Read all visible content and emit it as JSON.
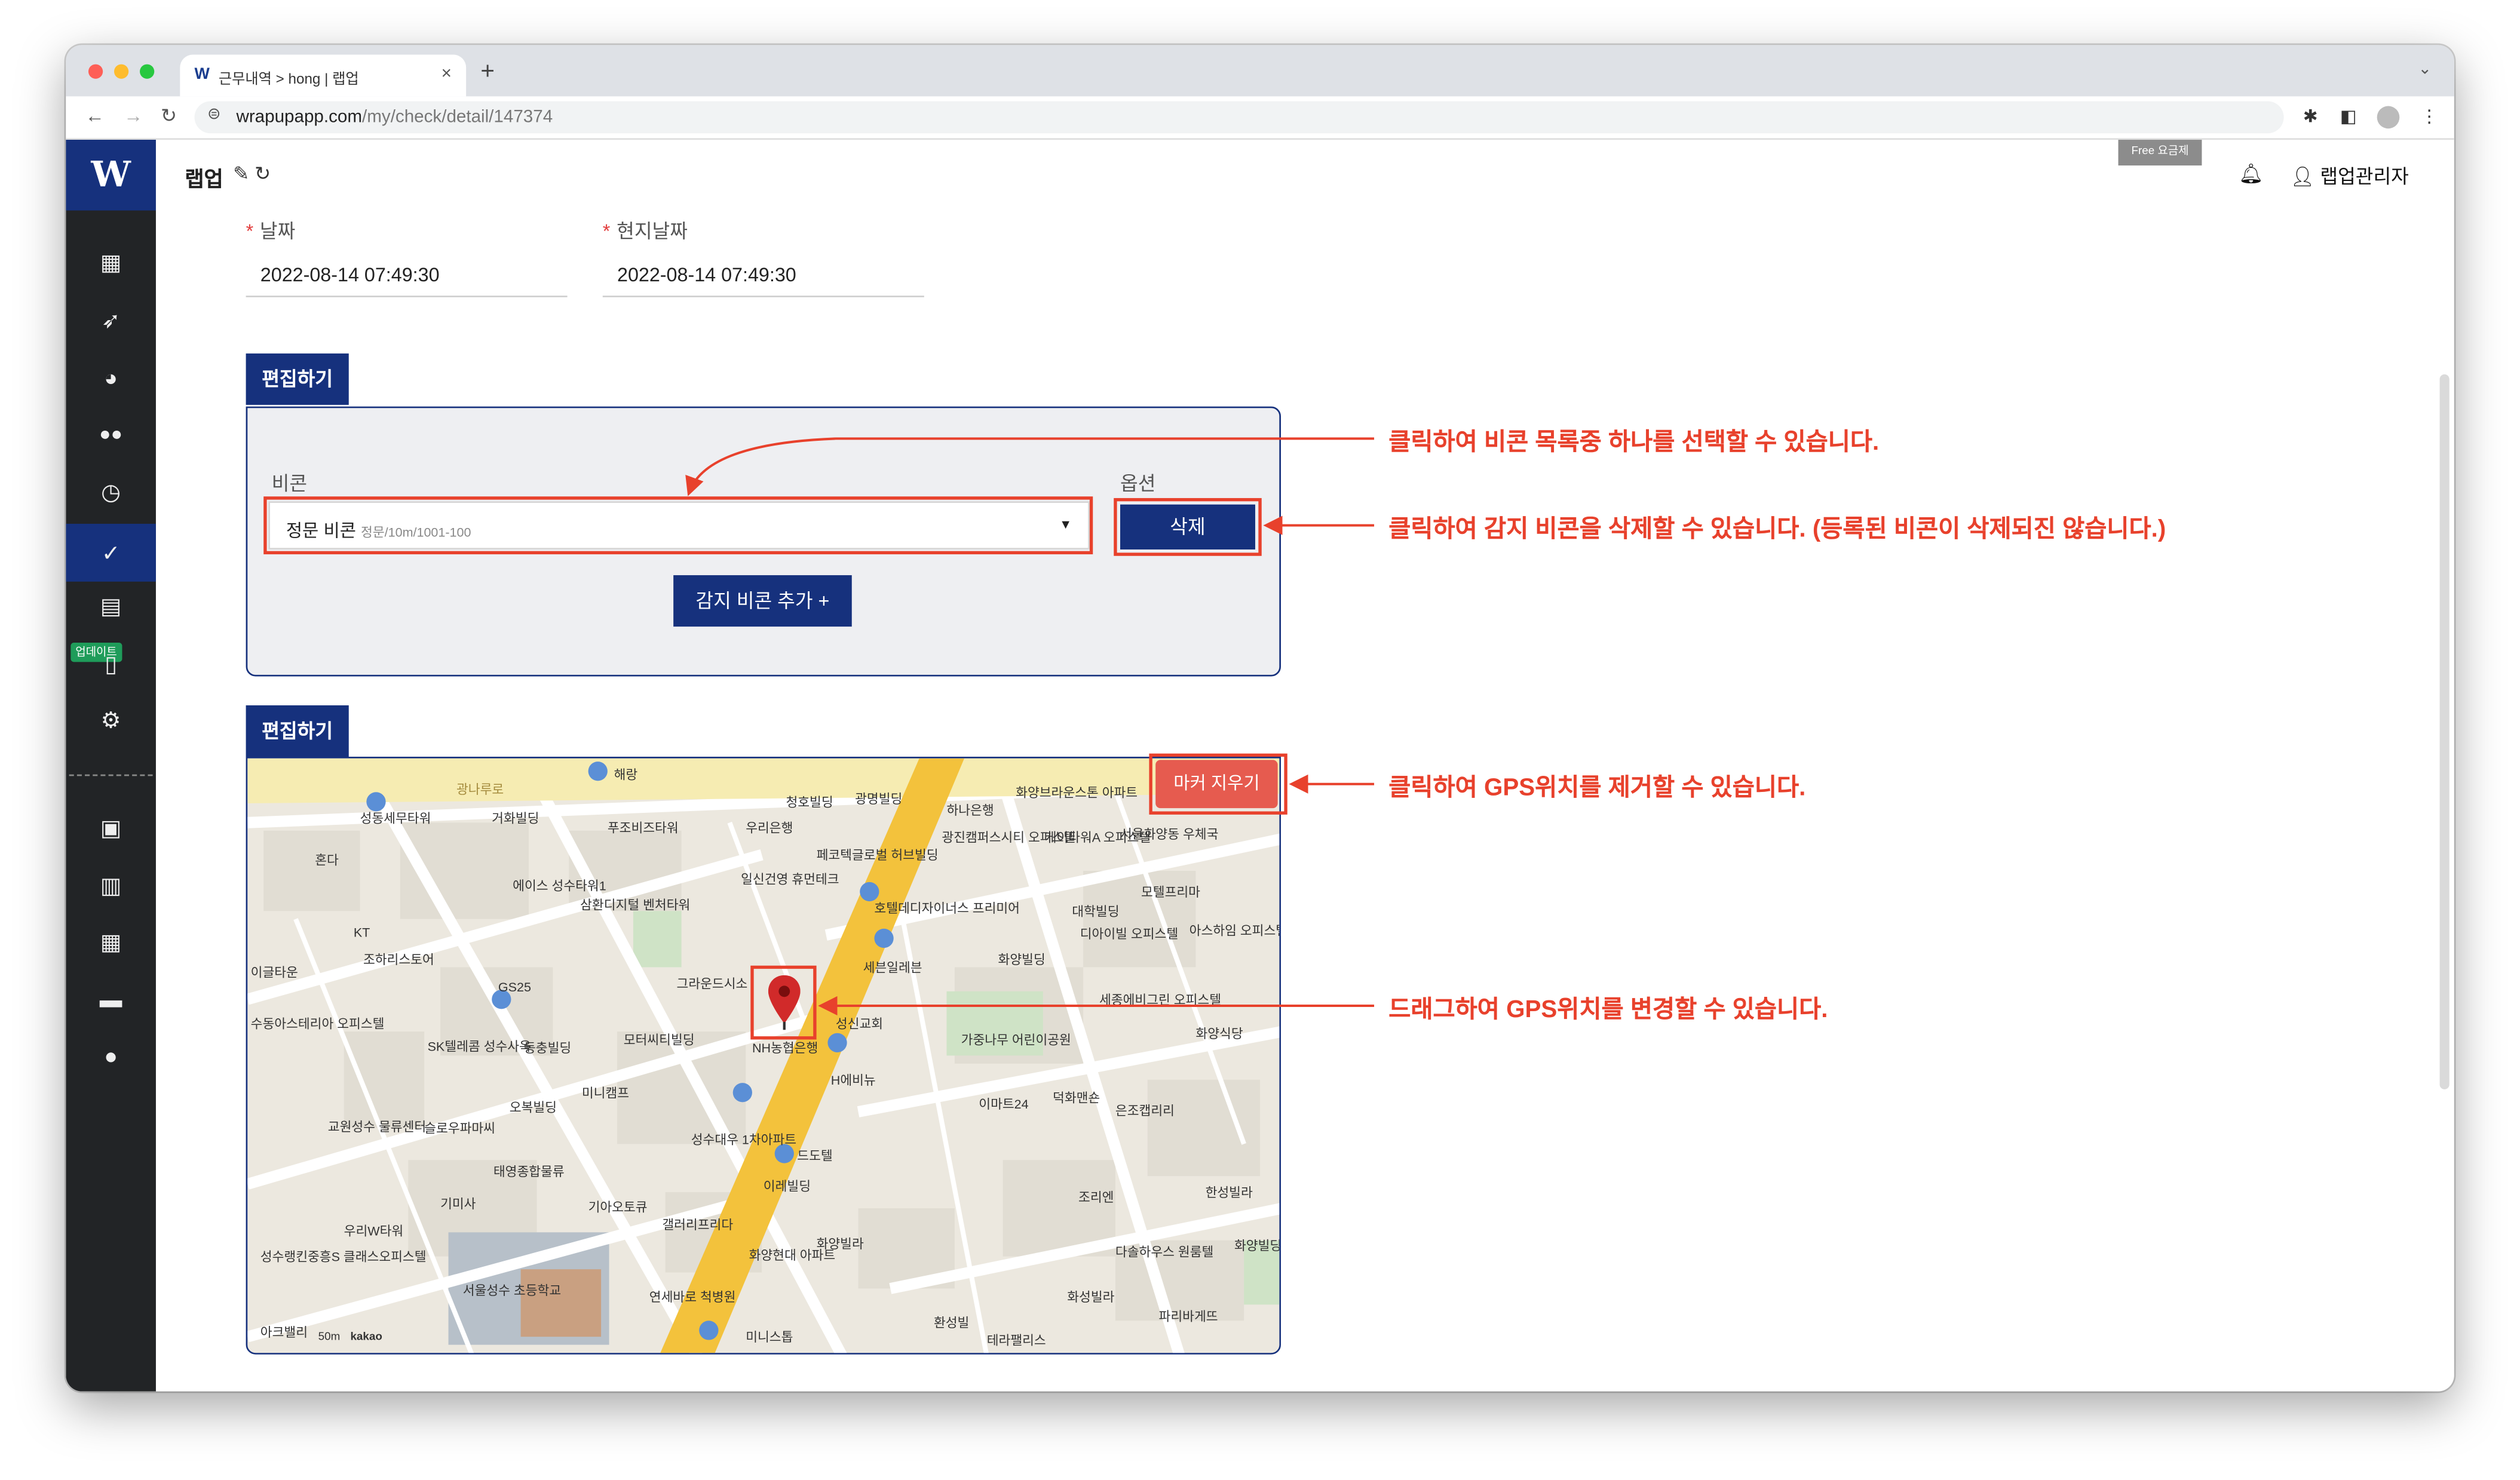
{
  "browser": {
    "tab_title": "근무내역 > hong | 랩업",
    "favicon": "W",
    "url_host": "wrapupapp.com",
    "url_path": "/my/check/detail/147374",
    "new_tab": "+",
    "close": "×"
  },
  "sidebar": {
    "logo": "W",
    "badge": "업데이트",
    "items": [
      {
        "icon": "dashboard-icon",
        "glyph": "▦"
      },
      {
        "icon": "rocket-icon",
        "glyph": "➶"
      },
      {
        "icon": "palette-icon",
        "glyph": "◕"
      },
      {
        "icon": "group-icon",
        "glyph": "👥"
      },
      {
        "icon": "alarm-icon",
        "glyph": "⏰"
      },
      {
        "icon": "check-icon",
        "glyph": "✓"
      },
      {
        "icon": "id-card-icon",
        "glyph": "▤"
      },
      {
        "icon": "mobile-icon",
        "glyph": "▯"
      },
      {
        "icon": "gear-icon",
        "glyph": "⚙"
      },
      {
        "icon": "contact-icon",
        "glyph": "▣"
      },
      {
        "icon": "building-icon",
        "glyph": "▥"
      },
      {
        "icon": "store-icon",
        "glyph": "▦"
      },
      {
        "icon": "chat-icon",
        "glyph": "▬"
      },
      {
        "icon": "help-chat-icon",
        "glyph": "●"
      }
    ]
  },
  "header": {
    "brand": "랩업",
    "plan_badge": "Free 요금제",
    "user": "랩업관리자"
  },
  "form": {
    "date_label": "날짜",
    "date_value": "2022-08-14 07:49:30",
    "local_date_label": "현지날짜",
    "local_date_value": "2022-08-14 07:49:30",
    "required_mark": "*"
  },
  "beacon_section": {
    "tab_label": "편집하기",
    "beacon_label": "비콘",
    "option_label": "옵션",
    "selected_beacon": "정문 비콘",
    "selected_beacon_detail": "정문/10m/1001-100",
    "delete_button": "삭제",
    "add_button": "감지 비콘 추가 +"
  },
  "map_section": {
    "tab_label": "편집하기",
    "clear_marker_button": "마커 지우기",
    "scale_label": "50m",
    "brand": "kakao"
  },
  "annotations": {
    "select_hint": "클릭하여 비콘 목록중 하나를 선택할 수 있습니다.",
    "delete_hint": "클릭하여 감지 비콘을 삭제할 수 있습니다. (등록된 비콘이 삭제되진 않습니다.)",
    "clear_hint": "클릭하여 GPS위치를 제거할 수 있습니다.",
    "drag_hint": "드래그하여 GPS위치를 변경할 수 있습니다."
  },
  "map_labels": [
    "해랑",
    "성동세무타워",
    "거화빌딩",
    "푸조비즈타워",
    "우리은행",
    "청호빌딩",
    "광명빌딩",
    "하나은행",
    "화양브라운스톤 아파트",
    "광진캠퍼스시티 오피스텔",
    "케이타워A 오피스텔",
    "서울화양동 우체국",
    "혼다",
    "에이스 성수타워1",
    "삼환디지털 벤처타워",
    "일신건영 휴먼테크",
    "페코텍글로벌 허브빌딩",
    "호텔데디자이너스 프리미어",
    "모텔프리마",
    "대학빌딩",
    "디아이빌 오피스텔",
    "아스하임 오피스텔",
    "KT",
    "조하리스토어",
    "GS25",
    "그라운드시소",
    "세븐일레븐",
    "화양빌딩",
    "이글타운",
    "수동아스테리아 오피스텔",
    "SK텔레콤 성수사옥",
    "동충빌딩",
    "모터씨티빌딩",
    "성신교회",
    "세종에비그린 오피스텔",
    "화양식당",
    "가중나무 어린이공원",
    "NH농협은행",
    "H에비뉴",
    "미니캠프",
    "오복빌딩",
    "이마트24",
    "덕화맨숀",
    "은조캡리리",
    "교원성수 물류센터",
    "슬로우파마씨",
    "성수대우 1차아파트",
    "드도텔",
    "태영종합물류",
    "이레빌딩",
    "기아오토큐",
    "갤러리프리다",
    "우리W타워",
    "기미사",
    "한성빌라",
    "조리엔",
    "화양빌라",
    "다솔하우스 원룸텔",
    "화양빌딩",
    "성수랭킨중흥S 클래스오피스텔",
    "서울성수 초등학교",
    "화양현대 아파트",
    "연세바로 척병원",
    "화성빌라",
    "파리바게뜨",
    "환성빌",
    "미니스톱",
    "테라팰리스",
    "아크밸리",
    "광나루로"
  ]
}
